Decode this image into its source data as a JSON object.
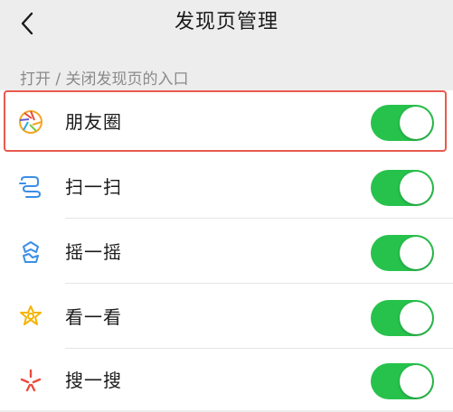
{
  "header": {
    "back_icon": "chevron-left-icon",
    "title": "发现页管理"
  },
  "section": {
    "caption": "打开 / 关闭发现页的入口"
  },
  "items": [
    {
      "label": "朋友圈",
      "icon": "moments-aperture-icon",
      "enabled": true,
      "highlighted": true
    },
    {
      "label": "扫一扫",
      "icon": "scan-icon",
      "enabled": true
    },
    {
      "label": "摇一摇",
      "icon": "shake-icon",
      "enabled": true
    },
    {
      "label": "看一看",
      "icon": "top-stories-icon",
      "enabled": true
    },
    {
      "label": "搜一搜",
      "icon": "search-sparkle-icon",
      "enabled": true
    }
  ],
  "colors": {
    "toggle_on": "#27c24c",
    "highlight_border": "#e85a4f",
    "background": "#ededed"
  }
}
